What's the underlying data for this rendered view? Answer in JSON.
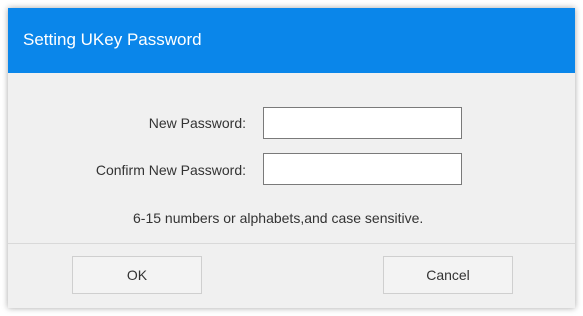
{
  "dialog": {
    "title": "Setting UKey Password",
    "fields": {
      "new_password_label": "New Password:",
      "new_password_value": "",
      "confirm_password_label": "Confirm New Password:",
      "confirm_password_value": ""
    },
    "hint": "6-15 numbers or alphabets,and case sensitive.",
    "buttons": {
      "ok": "OK",
      "cancel": "Cancel"
    },
    "colors": {
      "titlebar": "#0a86ea",
      "background": "#f0f0f0",
      "text": "#333333"
    }
  }
}
